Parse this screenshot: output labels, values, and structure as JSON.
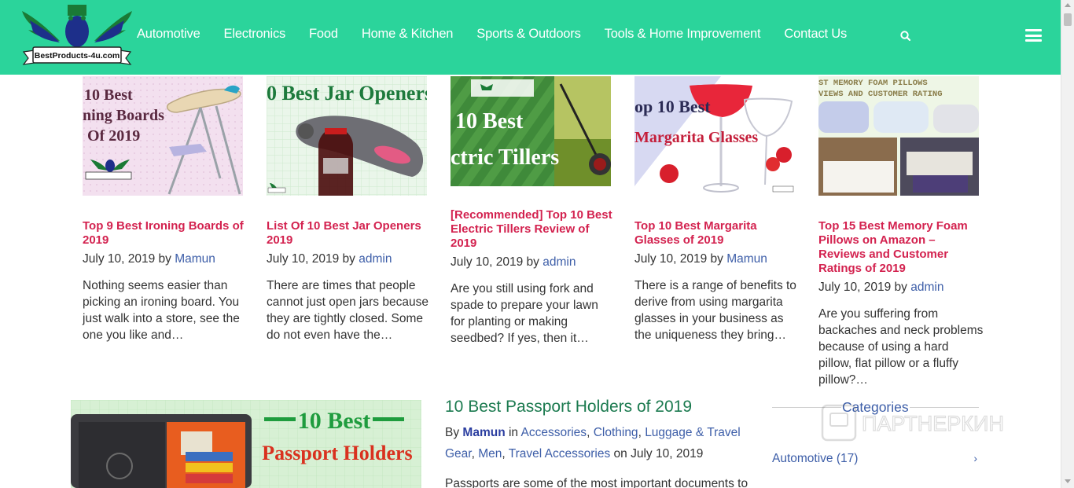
{
  "logo": {
    "text": "BestProducts-4u.com"
  },
  "nav": {
    "items": [
      {
        "label": "Automotive"
      },
      {
        "label": "Electronics"
      },
      {
        "label": "Food"
      },
      {
        "label": "Home & Kitchen"
      },
      {
        "label": "Sports & Outdoors"
      },
      {
        "label": "Tools & Home Improvement"
      },
      {
        "label": "Contact Us"
      }
    ]
  },
  "cards": [
    {
      "image_text": [
        "10 Best",
        "ning Boards",
        "Of 2019"
      ],
      "title": "Top 9 Best Ironing Boards of 2019",
      "date": "July 10, 2019",
      "by": "by",
      "author": "Mamun",
      "excerpt": "Nothing seems easier than picking an ironing board. You just walk into a store, see the one you like and…"
    },
    {
      "image_text": [
        "0 Best Jar Openers"
      ],
      "title": "List Of 10 Best Jar Openers 2019",
      "date": "July 10, 2019",
      "by": "by",
      "author": "admin",
      "excerpt": "There are times that people cannot just open jars because they are tightly closed. Some do not even have the…"
    },
    {
      "image_text": [
        "10 Best",
        "ctric Tillers"
      ],
      "title": "[Recommended] Top 10 Best Electric Tillers Review of 2019",
      "date": "July 10, 2019",
      "by": "by",
      "author": "admin",
      "excerpt": "Are you still using fork and spade to prepare your lawn for planting or making seedbed? If yes, then it…"
    },
    {
      "image_text": [
        "op 10 Best",
        "Margarita Glasses"
      ],
      "title": "Top 10 Best Margarita Glasses of 2019",
      "date": "July 10, 2019",
      "by": "by",
      "author": "Mamun",
      "excerpt": "There is a range of benefits to derive from using margarita glasses in your business as the uniqueness they bring…"
    },
    {
      "image_text": [
        "ST MEMORY FOAM PILLOWS",
        "VIEWS AND CUSTOMER RATING"
      ],
      "title": "Top 15 Best Memory Foam Pillows on Amazon – Reviews and Customer Ratings of 2019",
      "date": "July 10, 2019",
      "by": "by",
      "author": "admin",
      "excerpt": "Are you suffering from backaches and neck problems because of using a hard pillow, flat pillow or a fluffy pillow?…"
    }
  ],
  "featured": {
    "image_text": [
      "10 Best",
      "Passport Holders"
    ],
    "title": "10 Best Passport Holders of 2019",
    "by_label": "By",
    "author": "Mamun",
    "in_label": "in",
    "categories": [
      "Accessories",
      "Clothing",
      "Luggage & Travel Gear",
      "Men",
      "Travel Accessories"
    ],
    "on_label": "on",
    "date": "July 10, 2019",
    "excerpt": "Passports are some of the most important documents to"
  },
  "sidebar": {
    "heading": "Categories",
    "items": [
      {
        "label": "Automotive (17)"
      }
    ]
  },
  "watermark": {
    "text": "ПАРТНЕРКИН"
  },
  "colors": {
    "header": "#2bd49b",
    "title_red": "#d3224f",
    "link_blue": "#3d5ea8",
    "post_green": "#1b7a4f"
  }
}
